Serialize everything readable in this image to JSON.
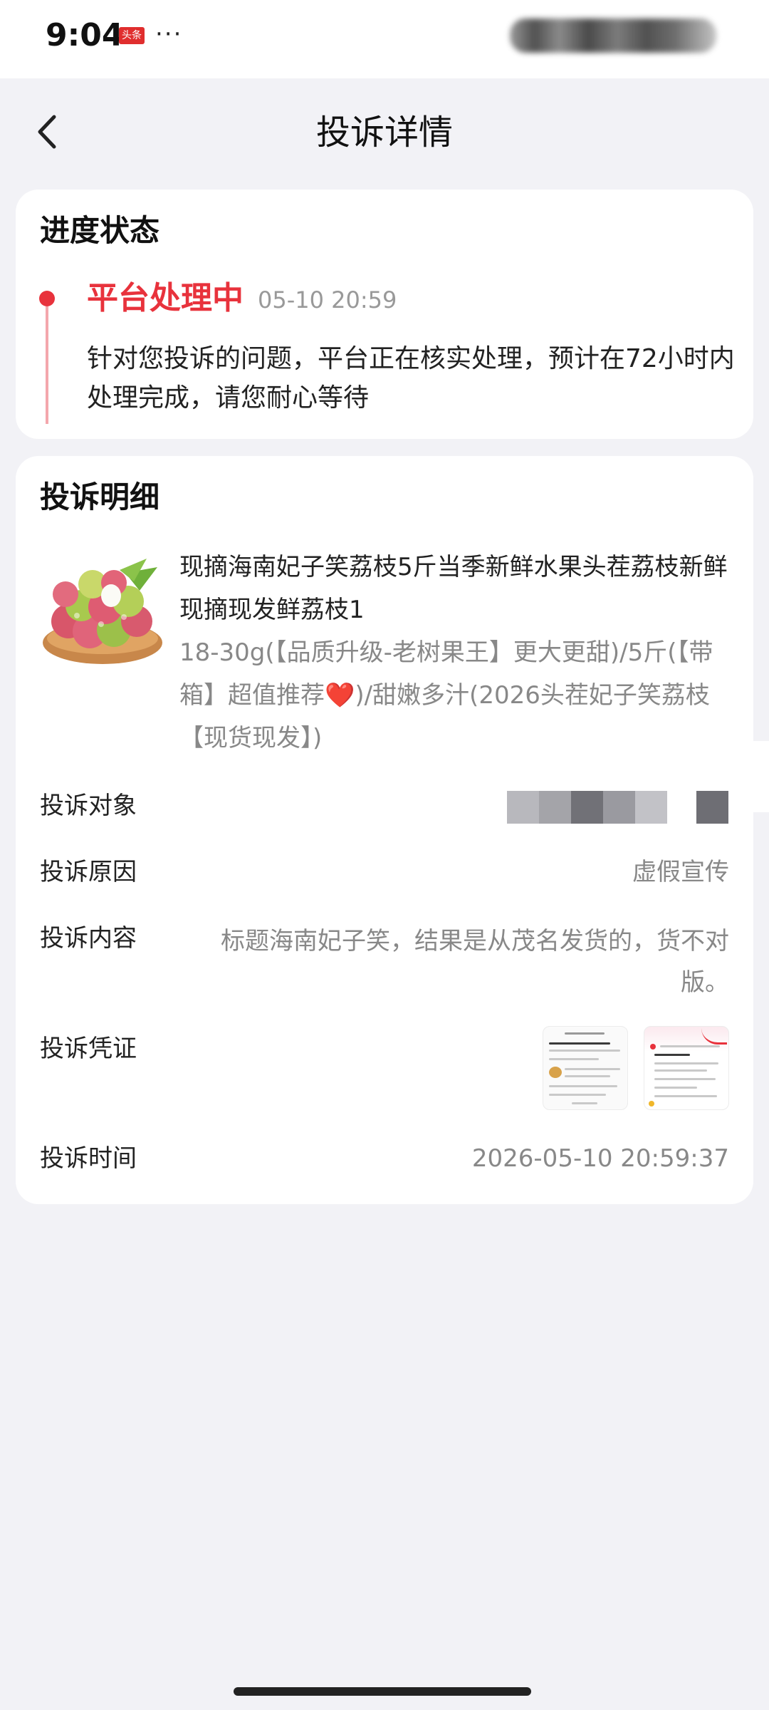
{
  "status_bar": {
    "time": "9:04",
    "app_badge": "头条",
    "more": "···"
  },
  "header": {
    "title": "投诉详情"
  },
  "progress": {
    "heading": "进度状态",
    "status": "平台处理中",
    "time": "05-10 20:59",
    "description": "针对您投诉的问题，平台正在核实处理，预计在72小时内处理完成，请您耐心等待",
    "accent_color": "#e8323c"
  },
  "detail": {
    "heading": "投诉明细",
    "product": {
      "title": "现摘海南妃子笑荔枝5斤当季新鲜水果头茬荔枝新鲜现摘现发鲜荔枝1",
      "spec": "18-30g(【品质升级-老树果王】更大更甜)/5斤(【带箱】超值推荐❤️)/甜嫩多汁(2026头茬妃子笑荔枝【现货现发】)"
    },
    "rows": {
      "target_label": "投诉对象",
      "reason_label": "投诉原因",
      "reason_value": "虚假宣传",
      "content_label": "投诉内容",
      "content_value": "标题海南妃子笑，结果是从茂名发货的，货不对版。",
      "evidence_label": "投诉凭证",
      "time_label": "投诉时间",
      "time_value": "2026-05-10 20:59:37"
    }
  }
}
